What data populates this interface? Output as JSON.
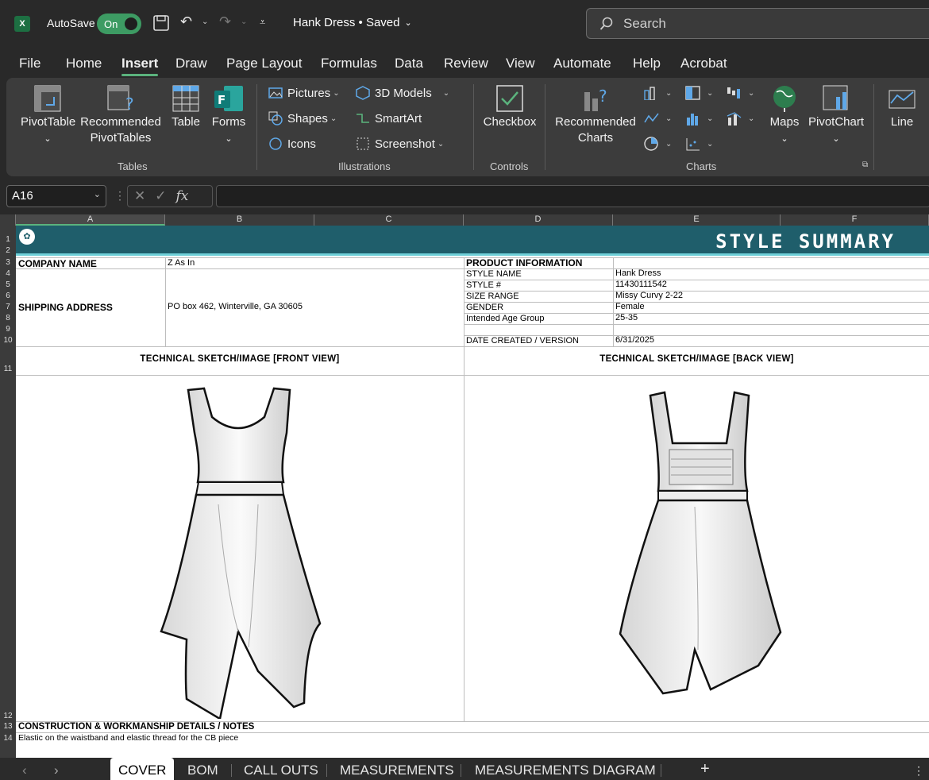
{
  "titlebar": {
    "autosave": "AutoSave",
    "toggle": "On",
    "doc_title": "Hank Dress • Saved",
    "search_placeholder": "Search"
  },
  "menu": {
    "tabs": [
      "File",
      "Home",
      "Insert",
      "Draw",
      "Page Layout",
      "Formulas",
      "Data",
      "Review",
      "View",
      "Automate",
      "Help",
      "Acrobat"
    ],
    "active": "Insert"
  },
  "ribbon": {
    "pivot_table": "PivotTable",
    "recommended_pivot": "Recommended PivotTables",
    "table": "Table",
    "forms": "Forms",
    "pictures": "Pictures",
    "shapes": "Shapes",
    "icons": "Icons",
    "models3d": "3D Models",
    "smartart": "SmartArt",
    "screenshot": "Screenshot",
    "checkbox": "Checkbox",
    "recommended_charts": "Recommended Charts",
    "maps": "Maps",
    "pivot_chart": "PivotChart",
    "line": "Line",
    "groups": {
      "tables": "Tables",
      "illustrations": "Illustrations",
      "controls": "Controls",
      "charts": "Charts"
    }
  },
  "formula": {
    "name_box": "A16",
    "fx": "fx",
    "value": ""
  },
  "columns": [
    "A",
    "B",
    "C",
    "D",
    "E",
    "F"
  ],
  "rows": [
    "1",
    "2",
    "3",
    "4",
    "5",
    "6",
    "7",
    "8",
    "9",
    "10",
    "11",
    "12",
    "13",
    "14"
  ],
  "sheet": {
    "banner": "STYLE SUMMARY",
    "company_label": "COMPANY NAME",
    "company_value": "Z As In",
    "shipping_label": "SHIPPING ADDRESS",
    "shipping_value": "PO box 462, Winterville, GA 30605",
    "product_info": "PRODUCT INFORMATION",
    "fields": [
      {
        "label": "STYLE NAME",
        "value": "Hank Dress"
      },
      {
        "label": "STYLE #",
        "value": "11430111542"
      },
      {
        "label": "SIZE RANGE",
        "value": "Missy Curvy 2-22"
      },
      {
        "label": "GENDER",
        "value": "Female"
      },
      {
        "label": "Intended Age Group",
        "value": "25-35"
      },
      {
        "label": "",
        "value": ""
      },
      {
        "label": "DATE  CREATED / VERSION",
        "value": "6/31/2025"
      }
    ],
    "front_title": "TECHNICAL SKETCH/IMAGE [FRONT VIEW]",
    "back_title": "TECHNICAL SKETCH/IMAGE [BACK VIEW]",
    "notes_label": "CONSTRUCTION & WORKMANSHIP DETAILS / NOTES",
    "notes_value": "Elastic on the waistband and elastic thread for the CB piece"
  },
  "sheet_tabs": [
    "COVER",
    "BOM",
    "CALL OUTS",
    "MEASUREMENTS",
    "MEASUREMENTS DIAGRAM"
  ],
  "add_sheet": "+"
}
